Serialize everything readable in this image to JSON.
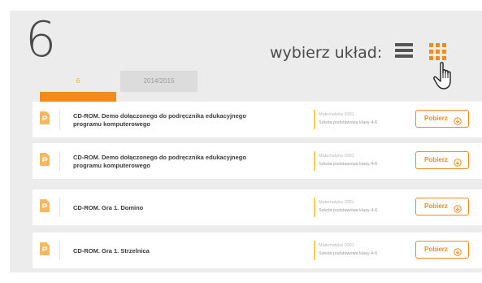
{
  "header": {
    "step_number": "6",
    "layout_label": "wybierz układ:",
    "layout_icons": {
      "list": "list-layout-icon",
      "grid": "grid-layout-icon",
      "cursor": "hand-pointer-icon"
    }
  },
  "tabs": [
    {
      "label": "6",
      "active": true
    },
    {
      "label": "2014/2015",
      "active": false
    }
  ],
  "items": [
    {
      "title_line1": "CD-ROM. Demo dołączonego do podręcznika edukacyjnego",
      "title_line2": "programu komputerowego",
      "subject": "Matematyka 2001",
      "school": "Szkoła podstawowa klasy 4-6",
      "button_label": "Pobierz",
      "icon": "file-icon"
    },
    {
      "title_line1": "CD-ROM. Demo dołączonego do podręcznika edukacyjnego",
      "title_line2": "programu komputerowego",
      "subject": "Matematyka 2001",
      "school": "Szkoła podstawowa klasy 4-6",
      "button_label": "Pobierz",
      "icon": "file-icon"
    },
    {
      "title_line1": "CD-ROM. Gra 1. Domino",
      "title_line2": "",
      "subject": "Matematyka 2001",
      "school": "Szkoła podstawowa klasy 4-6",
      "button_label": "Pobierz",
      "icon": "file-icon"
    },
    {
      "title_line1": "CD-ROM. Gra 1. Strzelnica",
      "title_line2": "",
      "subject": "Matematyka 2001",
      "school": "Szkoła podstawowa klasy 4-6",
      "button_label": "Pobierz",
      "icon": "file-icon"
    }
  ],
  "colors": {
    "accent": "#f08c1a",
    "panel_bg": "#ececec",
    "subject_bar": "#f3cf5a",
    "text_dark": "#3a3a3a"
  }
}
